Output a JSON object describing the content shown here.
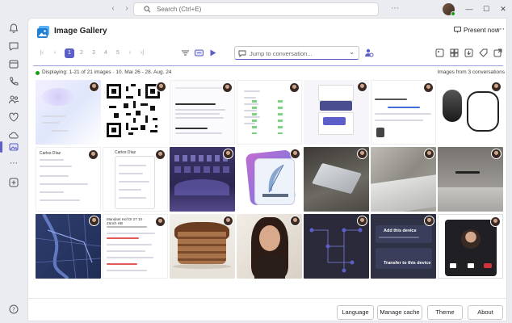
{
  "titlebar": {
    "search_placeholder": "Search (Ctrl+E)"
  },
  "app": {
    "title": "Image Gallery",
    "present_label": "Present now",
    "more_label": "⋯"
  },
  "toolbar": {
    "pages": [
      "1",
      "2",
      "3",
      "4",
      "5"
    ],
    "current_page": "1",
    "jump_placeholder": "Jump to conversation..."
  },
  "status": {
    "left": "Displaying: 1-21 of 21 images · 10. Mai 26 - 28. Aug. 24",
    "right": "Images from 3 conversations"
  },
  "thumb_texts": {
    "t8_name": "Carlos Díaz",
    "t9_name": "Carlos Díaz",
    "t16_text": "Mandant Hof DI 27 10 · Zürich HB",
    "t20_a": "Add this device",
    "t20_b": "Transfer to this device"
  },
  "footer": {
    "language": "Language",
    "cache": "Manage cache",
    "theme": "Theme",
    "about": "About"
  },
  "colors": {
    "accent": "#5b5fc7",
    "online": "#13a10e"
  }
}
